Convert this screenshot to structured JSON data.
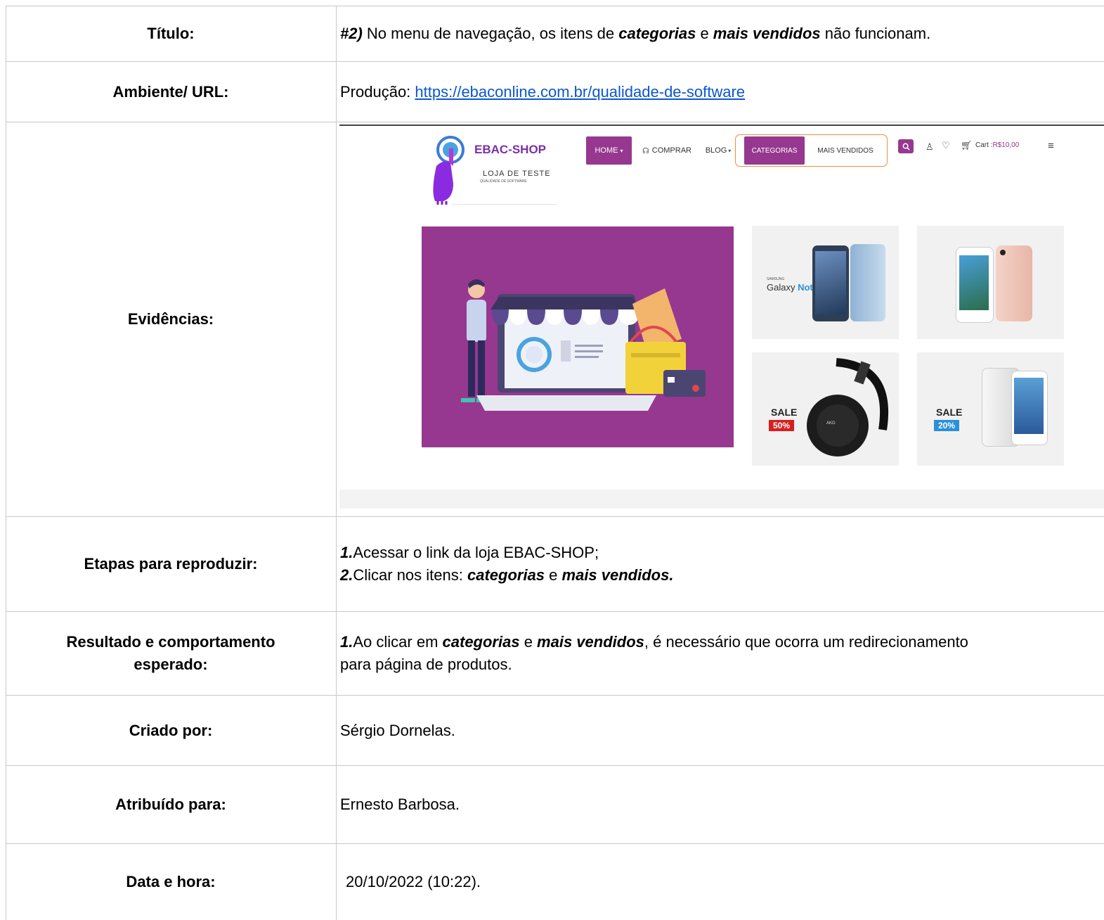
{
  "rows": {
    "titulo": {
      "label": "Título:",
      "prefix": "#2)",
      "text1": " No menu de navegação, os itens de ",
      "em1": "categorias",
      "text2": " e ",
      "em2": "mais vendidos",
      "text3": " não funcionam."
    },
    "ambiente": {
      "label": "Ambiente/ URL:",
      "prefix": "Produção: ",
      "url": "https://ebaconline.com.br/qualidade-de-software"
    },
    "evidencias": {
      "label": "Evidências:"
    },
    "etapas": {
      "label": "Etapas para reproduzir:",
      "step1_num": "1.",
      "step1_text": "Acessar o link da loja EBAC-SHOP;",
      "step2_num": "2.",
      "step2_text": "Clicar nos itens: ",
      "step2_em1": "categorias",
      "step2_mid": " e ",
      "step2_em2": "mais vendidos."
    },
    "resultado": {
      "label": "Resultado e comportamento esperado:",
      "num": "1.",
      "text1": "Ao clicar em ",
      "em1": "categorias",
      "text2": " e ",
      "em2": "mais vendidos",
      "text3": ", é necessário que ocorra um redirecionamento",
      "line2": "para página de produtos."
    },
    "criado": {
      "label": "Criado por:",
      "value": "Sérgio Dornelas."
    },
    "atribuido": {
      "label": "Atribuído para:",
      "value": "Ernesto Barbosa."
    },
    "data": {
      "label": "Data e hora:",
      "value": "20/10/2022 (10:22)."
    }
  },
  "shop": {
    "brand": "EBAC-SHOP",
    "tagline": "LOJA DE TESTE",
    "tagline_small": "QUALIDADE DE SOFTWARE",
    "nav": {
      "home": "HOME",
      "comprar": "COMPRAR",
      "blog": "BLOG",
      "categorias": "CATEGORIAS",
      "mais_vendidos": "MAIS VENDIDOS"
    },
    "cart": "Cart :",
    "cart_value": "R$10,00",
    "products": {
      "samsung_small": "SAMSUNG",
      "samsung": "Galaxy ",
      "samsung_model": "Note7",
      "sale1": "SALE",
      "sale1_pct": "50%",
      "sale2": "SALE",
      "sale2_pct": "20%",
      "headphone_brand": "AKG"
    },
    "colors": {
      "purple": "#96388f",
      "orange": "#e8913a",
      "sale_red": "#d62020",
      "sale_blue": "#2a90d8"
    }
  }
}
